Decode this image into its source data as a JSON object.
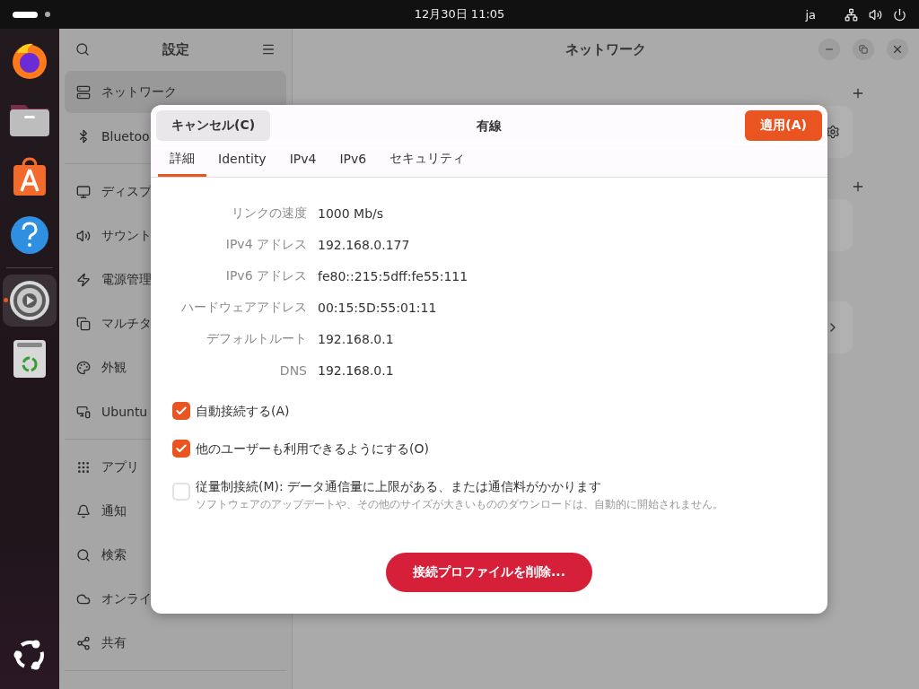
{
  "top_bar": {
    "clock": "12月30日  11:05",
    "input_method": "ja"
  },
  "dock": {
    "items": [
      {
        "kind": "firefox",
        "running": false
      },
      {
        "kind": "files",
        "running": false
      },
      {
        "kind": "appcenter",
        "running": false
      },
      {
        "kind": "help",
        "running": false
      },
      {
        "kind": "settings",
        "running": true
      },
      {
        "kind": "trash",
        "running": false
      }
    ]
  },
  "settings": {
    "sidebar": {
      "title": "設定",
      "groups": [
        [
          {
            "label": "ネットワーク",
            "selected": true
          },
          {
            "label": "Bluetoo",
            "selected": false
          }
        ],
        [
          {
            "label": "ディスプ",
            "selected": false
          },
          {
            "label": "サウント",
            "selected": false
          },
          {
            "label": "電源管理",
            "selected": false
          },
          {
            "label": "マルチタ",
            "selected": false
          },
          {
            "label": "外観",
            "selected": false
          },
          {
            "label": "Ubuntu",
            "selected": false
          }
        ],
        [
          {
            "label": "アプリ",
            "selected": false
          },
          {
            "label": "通知",
            "selected": false
          },
          {
            "label": "検索",
            "selected": false
          },
          {
            "label": "オンライ",
            "selected": false
          },
          {
            "label": "共有",
            "selected": false
          }
        ]
      ]
    },
    "main": {
      "title": "ネットワーク"
    }
  },
  "dialog": {
    "title": "有線",
    "cancel": "キャンセル(C)",
    "apply": "適用(A)",
    "tabs": [
      {
        "label": "詳細",
        "selected": true
      },
      {
        "label": "Identity",
        "selected": false
      },
      {
        "label": "IPv4",
        "selected": false
      },
      {
        "label": "IPv6",
        "selected": false
      },
      {
        "label": "セキュリティ",
        "selected": false
      }
    ],
    "details": [
      {
        "label": "リンクの速度",
        "value": "1000 Mb/s"
      },
      {
        "label": "IPv4 アドレス",
        "value": "192.168.0.177"
      },
      {
        "label": "IPv6 アドレス",
        "value": "fe80::215:5dff:fe55:111"
      },
      {
        "label": "ハードウェアアドレス",
        "value": "00:15:5D:55:01:11"
      },
      {
        "label": "デフォルトルート",
        "value": "192.168.0.1"
      },
      {
        "label": "DNS",
        "value": "192.168.0.1"
      }
    ],
    "options": [
      {
        "label": "自動接続する(A)",
        "checked": true
      },
      {
        "label": "他のユーザーも利用できるようにする(O)",
        "checked": true
      },
      {
        "label": "従量制接続(M): データ通信量に上限がある、または通信料がかかります",
        "description": "ソフトウェアのアップデートや、その他のサイズが大きいもののダウンロードは、自動的に開始されません。",
        "checked": false
      }
    ],
    "delete_button": "接続プロファイルを削除..."
  }
}
